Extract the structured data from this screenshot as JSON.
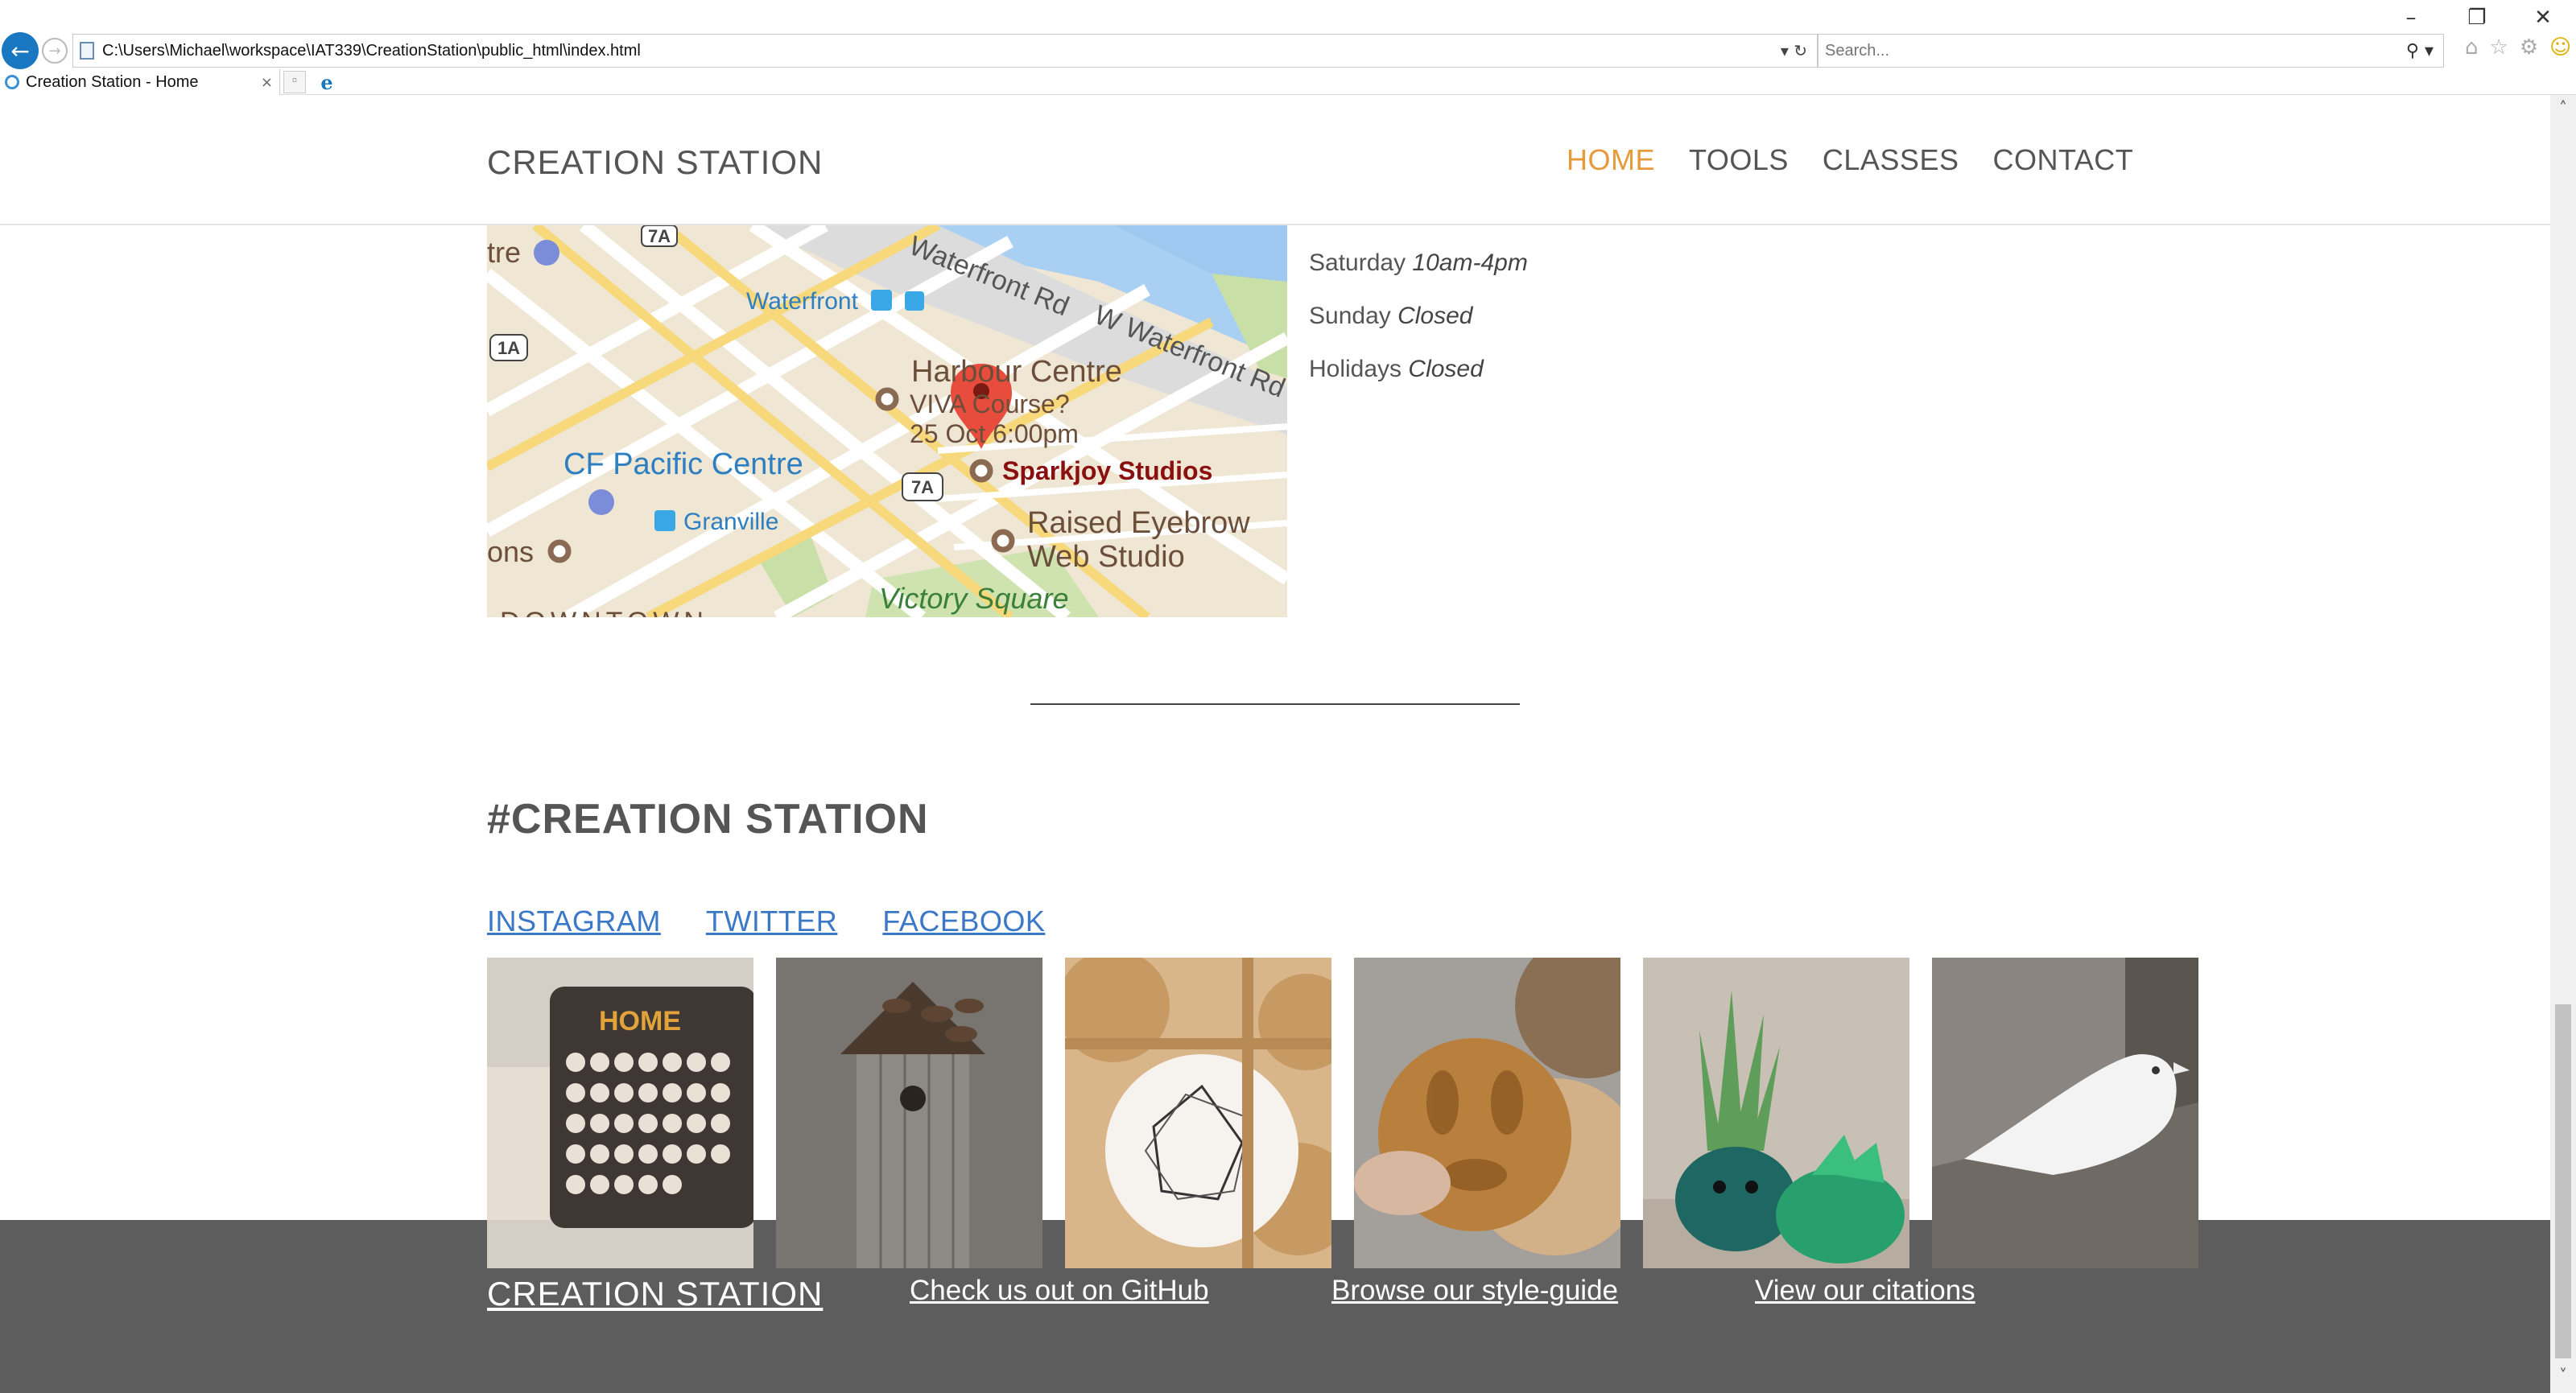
{
  "browser": {
    "url": "C:\\Users\\Michael\\workspace\\IAT339\\CreationStation\\public_html\\index.html",
    "search_placeholder": "Search...",
    "tab_title": "Creation Station - Home"
  },
  "header": {
    "brand": "CREATION STATION",
    "nav": [
      "HOME",
      "TOOLS",
      "CLASSES",
      "CONTACT"
    ],
    "active": "HOME"
  },
  "map": {
    "labels": {
      "waterfront_rd": "Waterfront Rd",
      "w_waterfront_rd": "W Waterfront Rd",
      "waterfront": "Waterfront",
      "harbour_centre": "Harbour Centre",
      "viva_line1": "VIVA Course?",
      "viva_line2": "25 Oct 6:00pm",
      "cf_pacific": "CF Pacific Centre",
      "granville": "Granville",
      "sparkjoy": "Sparkjoy Studios",
      "raised_line1": "Raised Eyebrow",
      "raised_line2": "Web Studio",
      "victory": "Victory Square",
      "tre": "tre",
      "ons": "ons",
      "downtown": "DOWNTOWN",
      "hwy_7a": "7A",
      "hwy_1a": "1A"
    }
  },
  "hours": [
    {
      "day": "Saturday",
      "time": "10am-4pm"
    },
    {
      "day": "Sunday",
      "time": "Closed"
    },
    {
      "day": "Holidays",
      "time": "Closed"
    }
  ],
  "social_section": {
    "title": "#CREATION STATION",
    "links": [
      "INSTAGRAM",
      "TWITTER",
      "FACEBOOK"
    ]
  },
  "gallery": {
    "calendar_text": "HOME"
  },
  "footer": {
    "brand": "CREATION STATION",
    "github": "Check us out on GitHub",
    "style_guide": "Browse our style-guide",
    "citations": "View our citations"
  }
}
